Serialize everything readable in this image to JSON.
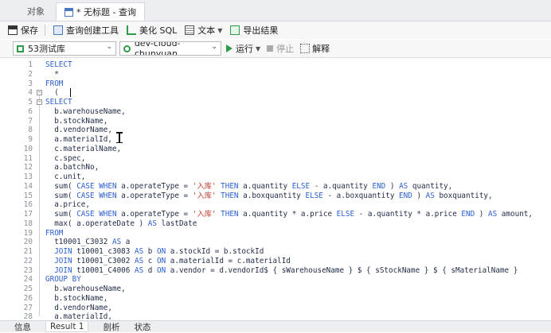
{
  "tabs": [
    {
      "label": "对象"
    },
    {
      "label": "* 无标题 - 查询"
    }
  ],
  "toolbar": {
    "save": "保存",
    "query_builder": "查询创建工具",
    "beautify": "美化 SQL",
    "text": "文本",
    "export": "导出结果"
  },
  "connection": {
    "value": "53测试库"
  },
  "database": {
    "value": "dev-cloud-chunyuan"
  },
  "run": {
    "label": "运行",
    "stop": "停止",
    "explain": "解释"
  },
  "editor": {
    "lines": [
      {
        "n": "1",
        "t": "SELECT"
      },
      {
        "n": "2",
        "t": "  *"
      },
      {
        "n": "3",
        "t": "FROM"
      },
      {
        "n": "4",
        "t": "  ("
      },
      {
        "n": "5",
        "t": "SELECT"
      },
      {
        "n": "6",
        "t": "  b.warehouseName,"
      },
      {
        "n": "7",
        "t": "  b.stockName,"
      },
      {
        "n": "8",
        "t": "  d.vendorName,"
      },
      {
        "n": "9",
        "t": "  a.materialId,"
      },
      {
        "n": "10",
        "t": "  c.materialName,"
      },
      {
        "n": "11",
        "t": "  c.spec,"
      },
      {
        "n": "12",
        "t": "  a.batchNo,"
      },
      {
        "n": "13",
        "t": "  c.unit,"
      },
      {
        "n": "14",
        "t": "  sum( CASE WHEN a.operateType = '入库' THEN a.quantity ELSE - a.quantity END ) AS quantity,"
      },
      {
        "n": "15",
        "t": "  sum( CASE WHEN a.operateType = '入库' THEN a.boxquantity ELSE - a.boxquantity END ) AS boxquantity,"
      },
      {
        "n": "16",
        "t": "  a.price,"
      },
      {
        "n": "17",
        "t": "  sum( CASE WHEN a.operateType = '入库' THEN a.quantity * a.price ELSE - a.quantity * a.price END ) AS amount,"
      },
      {
        "n": "18",
        "t": "  max( a.operateDate ) AS lastDate"
      },
      {
        "n": "19",
        "t": "FROM"
      },
      {
        "n": "20",
        "t": "  t10001_C3032 AS a"
      },
      {
        "n": "21",
        "t": "  JOIN t10001_c3083 AS b ON a.stockId = b.stockId"
      },
      {
        "n": "22",
        "t": "  JOIN t10001_C3002 AS c ON a.materialId = c.materialId"
      },
      {
        "n": "23",
        "t": "  JOIN t10001_C4006 AS d ON a.vendor = d.vendorId$ { sWarehouseName } $ { sStockName } $ { sMaterialName }"
      },
      {
        "n": "24",
        "t": "GROUP BY"
      },
      {
        "n": "25",
        "t": "  b.warehouseName,"
      },
      {
        "n": "26",
        "t": "  b.stockName,"
      },
      {
        "n": "27",
        "t": "  d.vendorName,"
      },
      {
        "n": "28",
        "t": "  a.materialId,"
      }
    ]
  },
  "bottom_tabs": [
    {
      "label": "信息"
    },
    {
      "label": "Result 1"
    },
    {
      "label": "剖析"
    },
    {
      "label": "状态"
    }
  ]
}
